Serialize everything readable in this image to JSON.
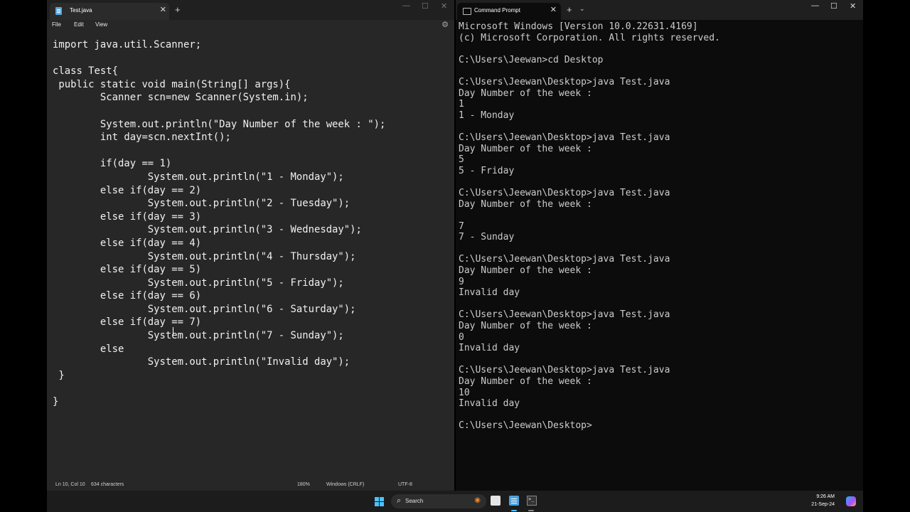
{
  "notepad": {
    "tab_title": "Test.java",
    "menu": [
      "File",
      "Edit",
      "View"
    ],
    "code_lines": [
      "import java.util.Scanner;",
      "",
      "class Test{",
      " public static void main(String[] args){",
      "        Scanner scn=new Scanner(System.in);",
      "",
      "        System.out.println(\"Day Number of the week : \");",
      "        int day=scn.nextInt();",
      "",
      "        if(day == 1)",
      "                System.out.println(\"1 - Monday\");",
      "        else if(day == 2)",
      "                System.out.println(\"2 - Tuesday\");",
      "        else if(day == 3)",
      "                System.out.println(\"3 - Wednesday\");",
      "        else if(day == 4)",
      "                System.out.println(\"4 - Thursday\");",
      "        else if(day == 5)",
      "                System.out.println(\"5 - Friday\");",
      "        else if(day == 6)",
      "                System.out.println(\"6 - Saturday\");",
      "        else if(day == 7)",
      "                System.out.println(\"7 - Sunday\");",
      "        else",
      "                System.out.println(\"Invalid day\");",
      " }",
      "",
      "}"
    ],
    "status": {
      "position": "Ln 10, Col 10",
      "characters": "634 characters",
      "zoom": "180%",
      "line_ending": "Windows (CRLF)",
      "encoding": "UTF-8"
    }
  },
  "terminal": {
    "tab_title": "Command Prompt",
    "output_lines": [
      "Microsoft Windows [Version 10.0.22631.4169]",
      "(c) Microsoft Corporation. All rights reserved.",
      "",
      "C:\\Users\\Jeewan>cd Desktop",
      "",
      "C:\\Users\\Jeewan\\Desktop>java Test.java",
      "Day Number of the week :",
      "1",
      "1 - Monday",
      "",
      "C:\\Users\\Jeewan\\Desktop>java Test.java",
      "Day Number of the week :",
      "5",
      "5 - Friday",
      "",
      "C:\\Users\\Jeewan\\Desktop>java Test.java",
      "Day Number of the week :",
      "",
      "7",
      "7 - Sunday",
      "",
      "C:\\Users\\Jeewan\\Desktop>java Test.java",
      "Day Number of the week :",
      "9",
      "Invalid day",
      "",
      "C:\\Users\\Jeewan\\Desktop>java Test.java",
      "Day Number of the week :",
      "0",
      "Invalid day",
      "",
      "C:\\Users\\Jeewan\\Desktop>java Test.java",
      "Day Number of the week :",
      "10",
      "Invalid day",
      "",
      "C:\\Users\\Jeewan\\Desktop>"
    ]
  },
  "taskbar": {
    "search_label": "Search",
    "time": "9:26 AM",
    "date": "21-Sep-24"
  },
  "icons": {
    "notepad_tab": "notepad-icon",
    "terminal_tab": "terminal-icon",
    "start": "windows-start-icon",
    "search": "search-icon",
    "settings": "gear-icon"
  },
  "colors": {
    "notepad_bg": "#272727",
    "terminal_bg": "#0c0c0c",
    "accent": "#4cc2ff"
  }
}
